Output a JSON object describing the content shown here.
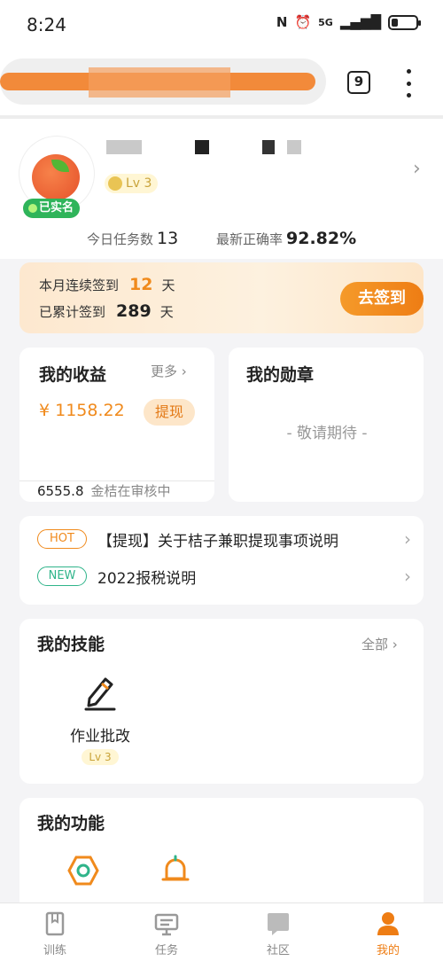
{
  "status_bar": {
    "time": "8:24",
    "network": "5G",
    "battery_level": 0.25
  },
  "browser": {
    "url": "(",
    "tab_count": "9"
  },
  "profile": {
    "verified_label": "已实名",
    "level": "Lv 3",
    "today_tasks_label": "今日任务数",
    "today_tasks_value": "13",
    "accuracy_label": "最新正确率",
    "accuracy_value": "92.82%"
  },
  "signin": {
    "streak_label": "本月连续签到",
    "streak_value": "12",
    "streak_unit": "天",
    "total_label": "已累计签到",
    "total_value": "289",
    "total_unit": "天",
    "button_label": "去签到"
  },
  "earnings": {
    "title": "我的收益",
    "more_label": "更多",
    "amount": "¥ 1158.22",
    "withdraw_label": "提现",
    "pending_value": "6555.8",
    "pending_label": "金桔在审核中"
  },
  "medals": {
    "title": "我的勋章",
    "placeholder": "- 敬请期待 -"
  },
  "notices": [
    {
      "tag": "HOT",
      "text": "【提现】关于桔子兼职提现事项说明"
    },
    {
      "tag": "NEW",
      "text": "2022报税说明"
    }
  ],
  "skills": {
    "title": "我的技能",
    "all_label": "全部",
    "items": [
      {
        "label": "作业批改",
        "level": "Lv 3",
        "icon": "pencil-icon"
      }
    ]
  },
  "functions": {
    "title": "我的功能",
    "icons": [
      "hexagon-icon",
      "bell-icon"
    ]
  },
  "tabbar": [
    {
      "label": "训练",
      "icon": "book-icon",
      "active": false
    },
    {
      "label": "任务",
      "icon": "task-board-icon",
      "active": false
    },
    {
      "label": "社区",
      "icon": "chat-bubble-icon",
      "active": false
    },
    {
      "label": "我的",
      "icon": "person-icon",
      "active": true
    }
  ],
  "colors": {
    "accent": "#ee7d14",
    "verified_green": "#2fb45a",
    "new_tag": "#2fb48a"
  }
}
